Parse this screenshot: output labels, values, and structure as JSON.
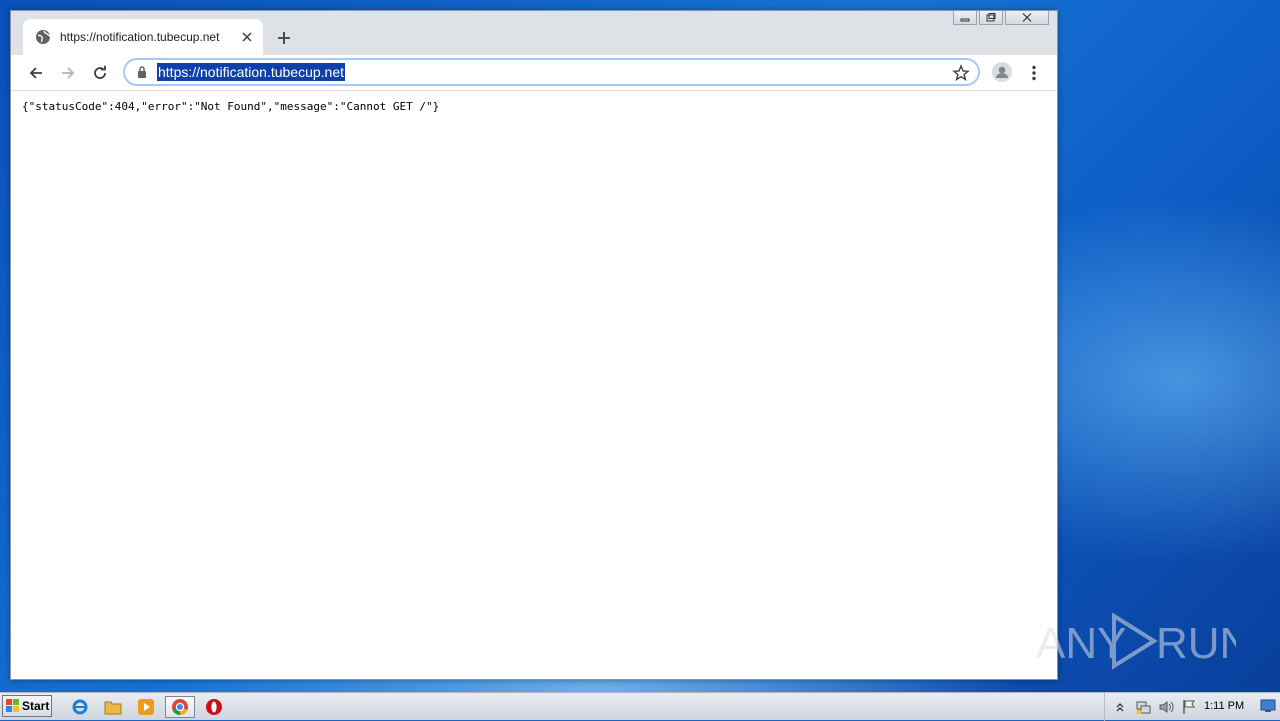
{
  "browser": {
    "tab": {
      "title": "https://notification.tubecup.net"
    },
    "address_bar": {
      "url": "https://notification.tubecup.net"
    }
  },
  "page": {
    "body_text": "{\"statusCode\":404,\"error\":\"Not Found\",\"message\":\"Cannot GET /\"}"
  },
  "watermark": {
    "text": "ANY RUN"
  },
  "taskbar": {
    "start_label": "Start",
    "clock": "1:11 PM",
    "apps": [
      "internet-explorer-icon",
      "file-explorer-icon",
      "media-player-icon",
      "chrome-icon",
      "opera-icon"
    ]
  },
  "colors": {
    "selection": "#0f3fa8",
    "omnibox_focus": "#a8c7fa",
    "desktop": "#1565c8"
  }
}
